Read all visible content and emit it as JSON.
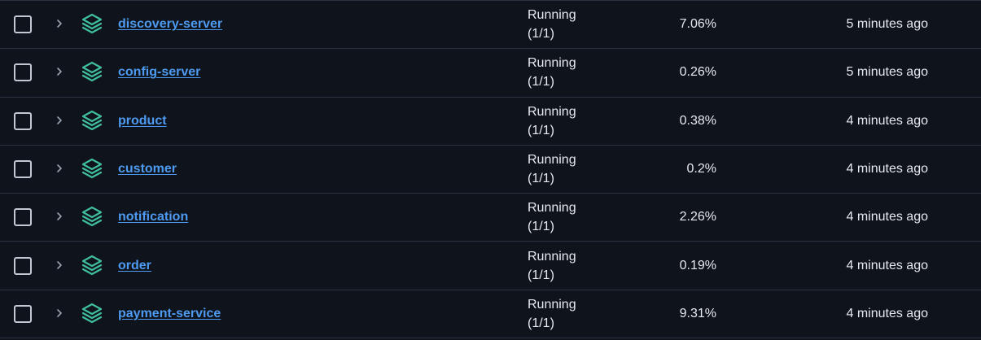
{
  "colors": {
    "background": "#0f141c",
    "divider": "#2a3140",
    "link": "#4d9af0",
    "icon": "#3fbf9e",
    "text": "#e6e9ee"
  },
  "rows": [
    {
      "name": "discovery-server",
      "status_line1": "Running",
      "status_line2": "(1/1)",
      "cpu": "7.06%",
      "age": "5 minutes ago",
      "icon": "layers-icon",
      "expand_icon": "chevron-right-icon"
    },
    {
      "name": "config-server",
      "status_line1": "Running",
      "status_line2": "(1/1)",
      "cpu": "0.26%",
      "age": "5 minutes ago",
      "icon": "layers-icon",
      "expand_icon": "chevron-right-icon"
    },
    {
      "name": "product",
      "status_line1": "Running",
      "status_line2": "(1/1)",
      "cpu": "0.38%",
      "age": "4 minutes ago",
      "icon": "layers-icon",
      "expand_icon": "chevron-right-icon"
    },
    {
      "name": "customer",
      "status_line1": "Running",
      "status_line2": "(1/1)",
      "cpu": "0.2%",
      "age": "4 minutes ago",
      "icon": "layers-icon",
      "expand_icon": "chevron-right-icon"
    },
    {
      "name": "notification",
      "status_line1": "Running",
      "status_line2": "(1/1)",
      "cpu": "2.26%",
      "age": "4 minutes ago",
      "icon": "layers-icon",
      "expand_icon": "chevron-right-icon"
    },
    {
      "name": "order",
      "status_line1": "Running",
      "status_line2": "(1/1)",
      "cpu": "0.19%",
      "age": "4 minutes ago",
      "icon": "layers-icon",
      "expand_icon": "chevron-right-icon"
    },
    {
      "name": "payment-service",
      "status_line1": "Running",
      "status_line2": "(1/1)",
      "cpu": "9.31%",
      "age": "4 minutes ago",
      "icon": "layers-icon",
      "expand_icon": "chevron-right-icon"
    }
  ]
}
